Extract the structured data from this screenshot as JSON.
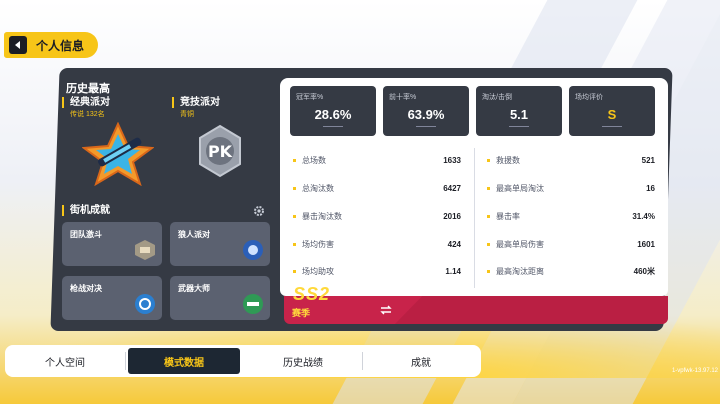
{
  "header": {
    "title": "个人信息"
  },
  "history": {
    "title": "历史最高",
    "classic": {
      "name": "经典派对",
      "rank": "传说 132名"
    },
    "competitive": {
      "name": "竞技派对",
      "rank": "青铜"
    }
  },
  "arcade": {
    "title": "街机成就",
    "cards": [
      "团队激斗",
      "狼人派对",
      "枪战对决",
      "武器大师"
    ]
  },
  "top_stats": [
    {
      "label": "冠军率%",
      "value": "28.6%"
    },
    {
      "label": "前十率%",
      "value": "63.9%"
    },
    {
      "label": "淘汰/击倒",
      "value": "5.1"
    },
    {
      "label": "场均评价",
      "value": "S"
    }
  ],
  "left_stats": [
    {
      "label": "总场数",
      "value": "1633"
    },
    {
      "label": "总淘汰数",
      "value": "6427"
    },
    {
      "label": "暴击淘汰数",
      "value": "2016"
    },
    {
      "label": "场均伤害",
      "value": "424"
    },
    {
      "label": "场均助攻",
      "value": "1.14"
    }
  ],
  "right_stats": [
    {
      "label": "救援数",
      "value": "521"
    },
    {
      "label": "最高单局淘汰",
      "value": "16"
    },
    {
      "label": "暴击率",
      "value": "31.4%"
    },
    {
      "label": "最高单局伤害",
      "value": "1601"
    },
    {
      "label": "最高淘汰距离",
      "value": "460米"
    }
  ],
  "season": {
    "code": "SS2",
    "label": "赛季"
  },
  "tabs": [
    "个人空间",
    "模式数据",
    "历史战绩",
    "成就"
  ],
  "active_tab": "模式数据",
  "version": "1-vpfwk-13.97.12",
  "colors": {
    "accent": "#f7c518",
    "panel": "#353a44",
    "season": "#c8234a"
  }
}
